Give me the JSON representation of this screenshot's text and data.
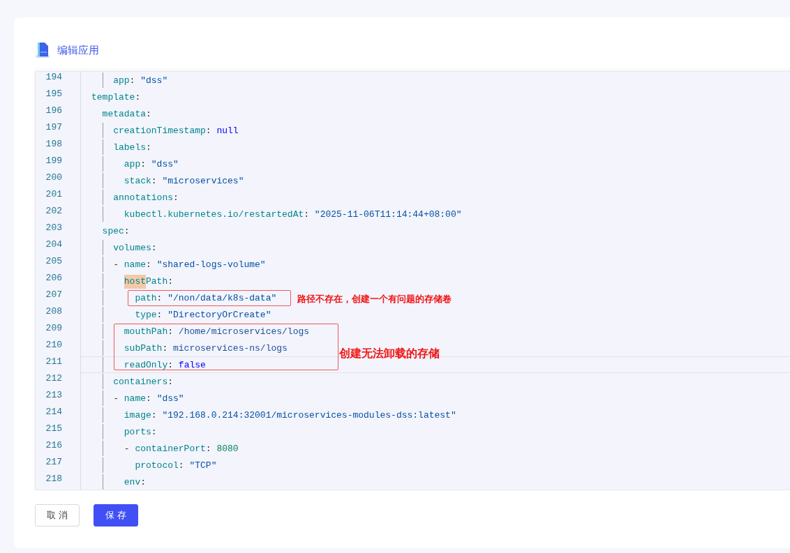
{
  "header": {
    "title": "编辑应用"
  },
  "editor": {
    "lines": [
      {
        "number": "194",
        "active": false,
        "tokens": [
          {
            "kind": "key",
            "text": "    app"
          },
          {
            "kind": "punct",
            "text": ": "
          },
          {
            "kind": "string",
            "text": "\"dss\""
          }
        ]
      },
      {
        "number": "195",
        "active": false,
        "tokens": [
          {
            "kind": "key",
            "text": "template"
          },
          {
            "kind": "punct",
            "text": ":"
          }
        ]
      },
      {
        "number": "196",
        "active": false,
        "tokens": [
          {
            "kind": "key",
            "text": "  metadata"
          },
          {
            "kind": "punct",
            "text": ":"
          }
        ]
      },
      {
        "number": "197",
        "active": false,
        "tokens": [
          {
            "kind": "key",
            "text": "    creationTimestamp"
          },
          {
            "kind": "punct",
            "text": ": "
          },
          {
            "kind": "keyword",
            "text": "null"
          }
        ]
      },
      {
        "number": "198",
        "active": false,
        "tokens": [
          {
            "kind": "key",
            "text": "    labels"
          },
          {
            "kind": "punct",
            "text": ":"
          }
        ]
      },
      {
        "number": "199",
        "active": false,
        "tokens": [
          {
            "kind": "key",
            "text": "      app"
          },
          {
            "kind": "punct",
            "text": ": "
          },
          {
            "kind": "string",
            "text": "\"dss\""
          }
        ]
      },
      {
        "number": "200",
        "active": false,
        "tokens": [
          {
            "kind": "key",
            "text": "      stack"
          },
          {
            "kind": "punct",
            "text": ": "
          },
          {
            "kind": "string",
            "text": "\"microservices\""
          }
        ]
      },
      {
        "number": "201",
        "active": false,
        "tokens": [
          {
            "kind": "key",
            "text": "    annotations"
          },
          {
            "kind": "punct",
            "text": ":"
          }
        ]
      },
      {
        "number": "202",
        "active": false,
        "tokens": [
          {
            "kind": "key",
            "text": "      kubectl.kubernetes.io/restartedAt"
          },
          {
            "kind": "punct",
            "text": ": "
          },
          {
            "kind": "string",
            "text": "\"2025-11-06T11:14:44+08:00\""
          }
        ]
      },
      {
        "number": "203",
        "active": false,
        "tokens": [
          {
            "kind": "key",
            "text": "  spec"
          },
          {
            "kind": "punct",
            "text": ":"
          }
        ]
      },
      {
        "number": "204",
        "active": false,
        "tokens": [
          {
            "kind": "key",
            "text": "    volumes"
          },
          {
            "kind": "punct",
            "text": ":"
          }
        ]
      },
      {
        "number": "205",
        "active": false,
        "tokens": [
          {
            "kind": "punct",
            "text": "    - "
          },
          {
            "kind": "key",
            "text": "name"
          },
          {
            "kind": "punct",
            "text": ": "
          },
          {
            "kind": "string",
            "text": "\"shared-logs-volume\""
          }
        ]
      },
      {
        "number": "206",
        "active": false,
        "tokens": [
          {
            "kind": "key",
            "text": "      host",
            "highlighted": true
          },
          {
            "kind": "key",
            "text": "Path",
            "highlighted": false
          },
          {
            "kind": "punct",
            "text": ":"
          }
        ]
      },
      {
        "number": "207",
        "active": false,
        "tokens": [
          {
            "kind": "key",
            "text": "        path"
          },
          {
            "kind": "punct",
            "text": ": "
          },
          {
            "kind": "string",
            "text": "\"/non/data/k8s-data\""
          }
        ]
      },
      {
        "number": "208",
        "active": false,
        "tokens": [
          {
            "kind": "key",
            "text": "        type"
          },
          {
            "kind": "punct",
            "text": ": "
          },
          {
            "kind": "string",
            "text": "\"DirectoryOrCreate\""
          }
        ]
      },
      {
        "number": "209",
        "active": false,
        "tokens": [
          {
            "kind": "key",
            "text": "      mouthPah"
          },
          {
            "kind": "punct",
            "text": ": "
          },
          {
            "kind": "plain",
            "text": "/home/microservices/logs"
          }
        ]
      },
      {
        "number": "210",
        "active": false,
        "tokens": [
          {
            "kind": "key",
            "text": "      subPath"
          },
          {
            "kind": "punct",
            "text": ": "
          },
          {
            "kind": "plain",
            "text": "microservices-ns/logs"
          }
        ]
      },
      {
        "number": "211",
        "active": true,
        "tokens": [
          {
            "kind": "key",
            "text": "      readOnly"
          },
          {
            "kind": "punct",
            "text": ": "
          },
          {
            "kind": "keyword",
            "text": "false"
          }
        ]
      },
      {
        "number": "212",
        "active": false,
        "tokens": [
          {
            "kind": "key",
            "text": "    containers"
          },
          {
            "kind": "punct",
            "text": ":"
          }
        ]
      },
      {
        "number": "213",
        "active": false,
        "tokens": [
          {
            "kind": "punct",
            "text": "    - "
          },
          {
            "kind": "key",
            "text": "name"
          },
          {
            "kind": "punct",
            "text": ": "
          },
          {
            "kind": "string",
            "text": "\"dss\""
          }
        ]
      },
      {
        "number": "214",
        "active": false,
        "tokens": [
          {
            "kind": "key",
            "text": "      image"
          },
          {
            "kind": "punct",
            "text": ": "
          },
          {
            "kind": "string",
            "text": "\"192.168.0.214:32001/microservices-modules-dss:latest\""
          }
        ]
      },
      {
        "number": "215",
        "active": false,
        "tokens": [
          {
            "kind": "key",
            "text": "      ports"
          },
          {
            "kind": "punct",
            "text": ":"
          }
        ]
      },
      {
        "number": "216",
        "active": false,
        "tokens": [
          {
            "kind": "punct",
            "text": "      - "
          },
          {
            "kind": "key",
            "text": "containerPort"
          },
          {
            "kind": "punct",
            "text": ": "
          },
          {
            "kind": "number",
            "text": "8080"
          }
        ]
      },
      {
        "number": "217",
        "active": false,
        "tokens": [
          {
            "kind": "key",
            "text": "        protocol"
          },
          {
            "kind": "punct",
            "text": ": "
          },
          {
            "kind": "string",
            "text": "\"TCP\""
          }
        ]
      },
      {
        "number": "218",
        "active": false,
        "tokens": [
          {
            "kind": "key",
            "text": "      env"
          },
          {
            "kind": "punct",
            "text": ":"
          }
        ]
      }
    ]
  },
  "annotations": [
    {
      "text": "路径不存在，创建一个有问题的存储卷",
      "kind": "small"
    },
    {
      "text": "创建无法卸载的存储",
      "kind": "large"
    }
  ],
  "buttons": [
    {
      "label": "取 消",
      "kind": "default"
    },
    {
      "label": "保 存",
      "kind": "primary"
    }
  ]
}
